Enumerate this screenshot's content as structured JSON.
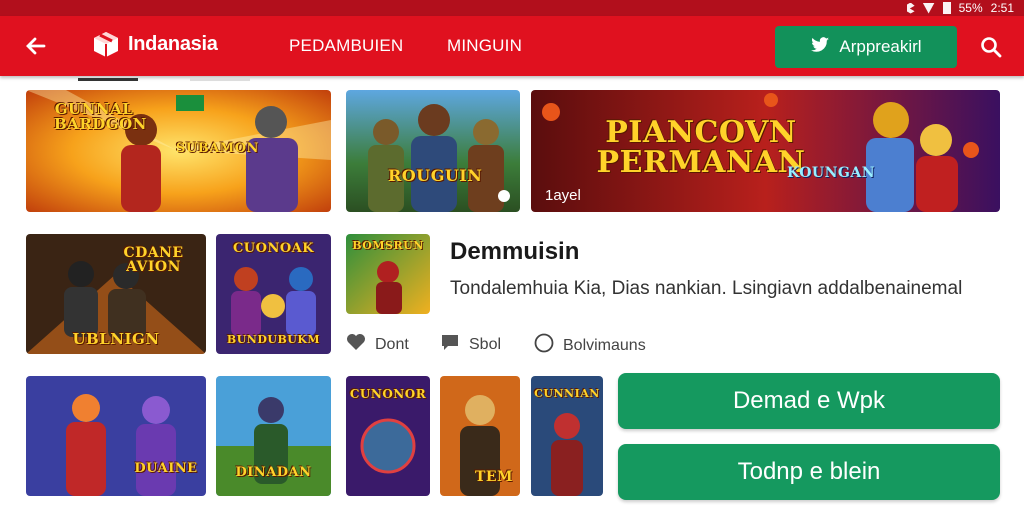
{
  "status_bar": {
    "time": "2:51",
    "battery": "55%"
  },
  "header": {
    "logo_text": "Indanasia",
    "tabs": [
      {
        "label": "PEDAMBUIEN"
      },
      {
        "label": "MINGUIN"
      }
    ],
    "cta_label": "Arppreakirl",
    "icons": [
      "back-arrow-icon",
      "logo-cube-icon",
      "twitter-bird-icon",
      "search-icon"
    ]
  },
  "banners": [
    {
      "title": "GUNNAL BARDGON",
      "sub": "SUBAMON",
      "badge": ""
    },
    {
      "title": "ROUGUIN",
      "sub": "",
      "badge": ""
    },
    {
      "title": "PIANCOVN PERMANAN",
      "sub": "KOUNGAN",
      "badge": "1ayel"
    }
  ],
  "row2": [
    {
      "title": "CDANE AVION",
      "sub": "UBLNIGN"
    },
    {
      "title": "CUONOAK",
      "sub": "BUNDUBUKM"
    },
    {
      "title": "BOMSRUN",
      "sub": ""
    }
  ],
  "detail": {
    "title": "Demmuisin",
    "description": "Tondalemhuia Kia, Dias nankian. Lsingiavn addalbenainemal",
    "meta": [
      {
        "icon": "heart-icon",
        "label": "Dont"
      },
      {
        "icon": "comment-icon",
        "label": "Sbol"
      },
      {
        "icon": "circle-icon",
        "label": "Bolvimauns"
      }
    ]
  },
  "row3": [
    {
      "title": "DUAINE"
    },
    {
      "title": "DINADAN"
    },
    {
      "title": "CUNONOR"
    },
    {
      "title": "TEM"
    },
    {
      "title": "CUNNIAN"
    }
  ],
  "buttons": {
    "primary": "Demad e Wpk",
    "secondary": "Todnp e blein"
  },
  "colors": {
    "brand_red": "#e0111f",
    "accent_green": "#15995f"
  }
}
